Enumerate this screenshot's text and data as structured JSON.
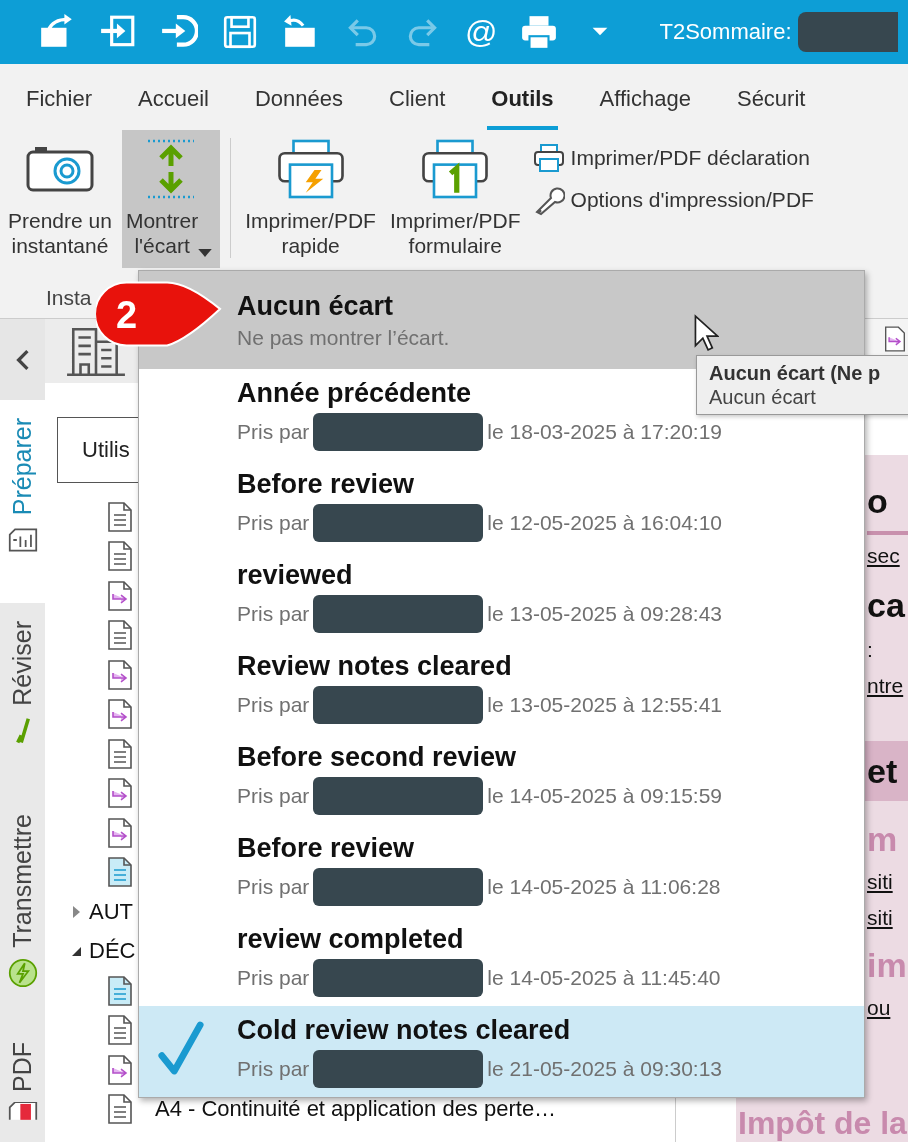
{
  "title_bar": {
    "quick_access": [
      {
        "kind": "export"
      },
      {
        "kind": "import"
      },
      {
        "kind": "import-round"
      },
      {
        "kind": "save"
      },
      {
        "kind": "open"
      },
      {
        "kind": "undo",
        "disabled": true
      },
      {
        "kind": "redo",
        "disabled": true
      },
      {
        "kind": "email",
        "glyph": "@"
      },
      {
        "kind": "print"
      },
      {
        "kind": "dropdown"
      }
    ],
    "title": "T2Sommaire:"
  },
  "ribbon_tabs": [
    {
      "label": "Fichier",
      "selected": false
    },
    {
      "label": "Accueil",
      "selected": false
    },
    {
      "label": "Données",
      "selected": false
    },
    {
      "label": "Client",
      "selected": false
    },
    {
      "label": "Outils",
      "selected": true
    },
    {
      "label": "Affichage",
      "selected": false
    },
    {
      "label": "Sécurit",
      "selected": false
    }
  ],
  "ribbon": {
    "buttons": [
      {
        "kind": "camera",
        "label": "Prendre un\ninstantané",
        "pressed": false
      },
      {
        "kind": "difference",
        "label": "Montrer\nl'écart",
        "pressed": true
      },
      {
        "kind": "quick-print",
        "label": "Imprimer/PDF\nrapide",
        "pressed": false
      },
      {
        "kind": "form-print",
        "label": "Imprimer/PDF\nformulaire",
        "pressed": false
      }
    ],
    "small_buttons": [
      {
        "kind": "printer",
        "label": "Imprimer/PDF déclaration"
      },
      {
        "kind": "wrench",
        "label": "Options d'impression/PDF"
      }
    ],
    "group_label": "Insta"
  },
  "side_tabs": [
    {
      "kind": "prepare",
      "label": "Préparer",
      "selected": true
    },
    {
      "kind": "review",
      "label": "Réviser",
      "selected": false
    },
    {
      "kind": "transmit",
      "label": "Transmettre",
      "selected": false
    },
    {
      "kind": "pdf",
      "label": "PDF",
      "selected": false
    }
  ],
  "tree": {
    "filter_value": "Utilis",
    "items": [
      {
        "kind": "doc"
      },
      {
        "kind": "doc"
      },
      {
        "kind": "arrow-doc"
      },
      {
        "kind": "doc"
      },
      {
        "kind": "arrow-doc"
      },
      {
        "kind": "arrow-doc"
      },
      {
        "kind": "doc"
      },
      {
        "kind": "arrow-doc"
      },
      {
        "kind": "arrow-doc"
      },
      {
        "kind": "blue-doc"
      },
      {
        "kind": "folder",
        "label": "AUT",
        "expanded": false
      },
      {
        "kind": "folder",
        "label": "DÉC",
        "expanded": true,
        "children": [
          {
            "kind": "blue-doc"
          },
          {
            "kind": "doc"
          },
          {
            "kind": "arrow-doc"
          },
          {
            "kind": "doc",
            "label": "A4 - Continuité et application des perte…"
          }
        ]
      }
    ]
  },
  "snapshot_menu": {
    "callout": "2",
    "items": [
      {
        "name": "Aucun écart",
        "description": "Ne pas montrer l’écart.",
        "hovered": true,
        "checked": false
      },
      {
        "name": "Année précédente",
        "taken_by": "Pris par",
        "date": "le 18-03-2025 à 17:20:19",
        "hovered": false,
        "checked": false
      },
      {
        "name": "Before review",
        "taken_by": "Pris par",
        "date": "le 12-05-2025 à 16:04:10",
        "hovered": false,
        "checked": false
      },
      {
        "name": "reviewed",
        "taken_by": "Pris par",
        "date": "le 13-05-2025 à 09:28:43",
        "hovered": false,
        "checked": false
      },
      {
        "name": "Review notes cleared",
        "taken_by": "Pris par",
        "date": "le 13-05-2025 à 12:55:41",
        "hovered": false,
        "checked": false
      },
      {
        "name": "Before second review",
        "taken_by": "Pris par",
        "date": "le 14-05-2025 à 09:15:59",
        "hovered": false,
        "checked": false
      },
      {
        "name": "Before review",
        "taken_by": "Pris par",
        "date": "le 14-05-2025 à 11:06:28",
        "hovered": false,
        "checked": false
      },
      {
        "name": "review completed",
        "taken_by": "Pris par",
        "date": "le 14-05-2025 à 11:45:40",
        "hovered": false,
        "checked": false
      },
      {
        "name": "Cold review notes cleared",
        "taken_by": "Pris par",
        "date": "le 21-05-2025 à 09:30:13",
        "hovered": false,
        "checked": true
      }
    ]
  },
  "tooltip": {
    "title": "Aucun écart (Ne p",
    "text": "Aucun écart"
  },
  "document": {
    "fragments": [
      {
        "kind": "heading",
        "text": "o"
      },
      {
        "kind": "underlined",
        "text": "sec"
      },
      {
        "kind": "heading",
        "text": "ca"
      },
      {
        "kind": "plain",
        "text": ":"
      },
      {
        "kind": "underlined",
        "text": "ntre"
      },
      {
        "kind": "band",
        "text": "et"
      },
      {
        "kind": "pink",
        "text": "m"
      },
      {
        "kind": "underlined",
        "text": "siti"
      },
      {
        "kind": "underlined",
        "text": "siti"
      },
      {
        "kind": "pink",
        "text": "im"
      },
      {
        "kind": "underlined",
        "text": "ou"
      }
    ],
    "section_title": "Impôt de la"
  }
}
